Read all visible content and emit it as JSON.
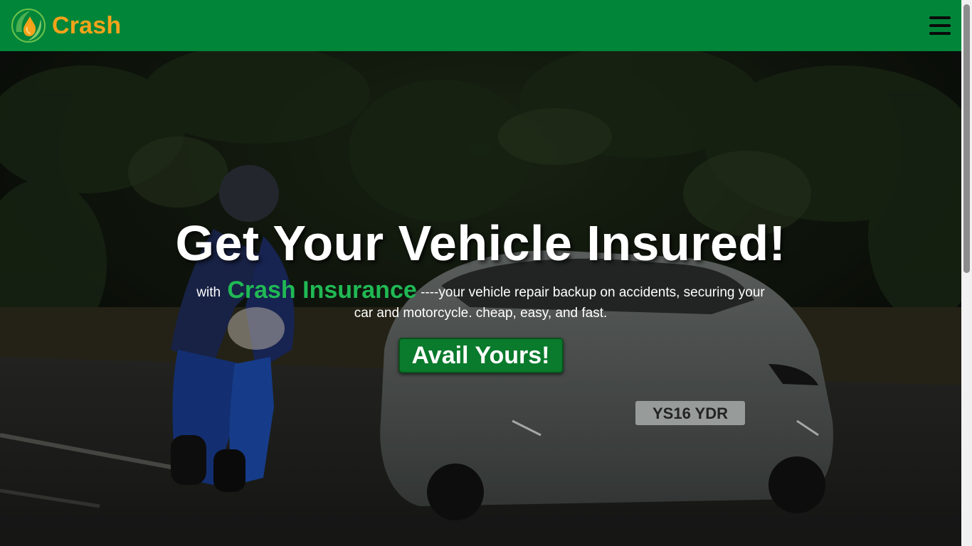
{
  "navbar": {
    "brand_name": "Crash",
    "logo_icon": "leaf-drop-icon",
    "menu_icon": "hamburger-menu-icon"
  },
  "hero": {
    "headline": "Get Your Vehicle Insured!",
    "tagline_prefix": "with",
    "tagline_brand": "Crash Insurance",
    "tagline_rest": "----your vehicle repair backup on accidents, securing your car and motorcycle. cheap, easy, and fast.",
    "cta_label": "Avail Yours!",
    "background_description_icon": "motorcycle-and-car-photo",
    "license_plate": "YS16 YDR"
  },
  "colors": {
    "navbar_bg": "#008539",
    "brand_text": "#f5a31a",
    "brand_highlight": "#20b954",
    "cta_bg": "#0a7a2c"
  }
}
